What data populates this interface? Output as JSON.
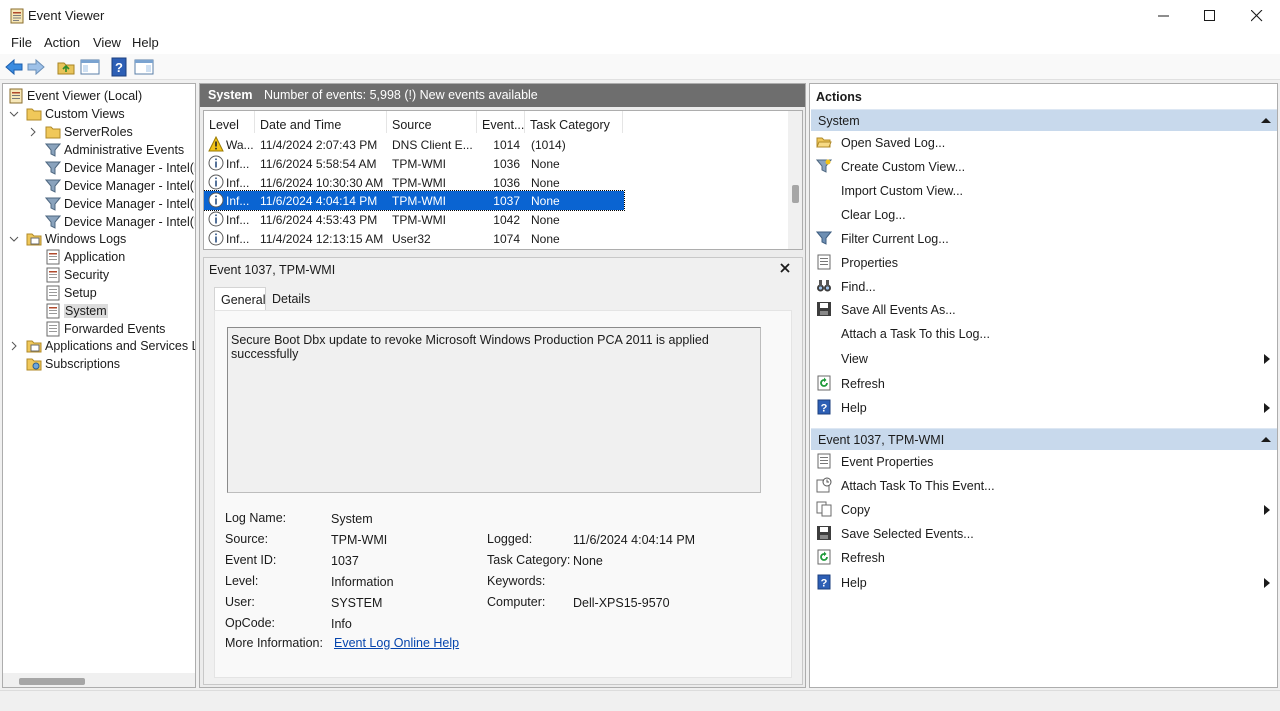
{
  "window": {
    "title": "Event Viewer"
  },
  "menu": {
    "items": [
      "File",
      "Action",
      "View",
      "Help"
    ]
  },
  "tree": {
    "root": "Event Viewer (Local)",
    "custom_views": "Custom Views",
    "custom_children": [
      "ServerRoles",
      "Administrative Events",
      "Device Manager - Intel(R)",
      "Device Manager - Intel(R)",
      "Device Manager - Intel(R)",
      "Device Manager - Intel(R)"
    ],
    "windows_logs": "Windows Logs",
    "windows_children": [
      "Application",
      "Security",
      "Setup",
      "System",
      "Forwarded Events"
    ],
    "apps_services": "Applications and Services Log",
    "subscriptions": "Subscriptions"
  },
  "center": {
    "log_name": "System",
    "summary": "Number of events: 5,998 (!) New events available",
    "columns": [
      "Level",
      "Date and Time",
      "Source",
      "Event...",
      "Task Category"
    ],
    "rows": [
      {
        "level": "Wa...",
        "type": "warning",
        "date": "11/4/2024 2:07:43 PM",
        "source": "DNS Client E...",
        "id": "1014",
        "cat": "(1014)"
      },
      {
        "level": "Inf...",
        "type": "info",
        "date": "11/6/2024 5:58:54 AM",
        "source": "TPM-WMI",
        "id": "1036",
        "cat": "None"
      },
      {
        "level": "Inf...",
        "type": "info",
        "date": "11/6/2024 10:30:30 AM",
        "source": "TPM-WMI",
        "id": "1036",
        "cat": "None"
      },
      {
        "level": "Inf...",
        "type": "info",
        "date": "11/6/2024 4:04:14 PM",
        "source": "TPM-WMI",
        "id": "1037",
        "cat": "None"
      },
      {
        "level": "Inf...",
        "type": "info",
        "date": "11/6/2024 4:53:43 PM",
        "source": "TPM-WMI",
        "id": "1042",
        "cat": "None"
      },
      {
        "level": "Inf...",
        "type": "info",
        "date": "11/4/2024 12:13:15 AM",
        "source": "User32",
        "id": "1074",
        "cat": "None"
      }
    ],
    "selected_row": 3
  },
  "detail": {
    "title": "Event 1037, TPM-WMI",
    "tabs": [
      "General",
      "Details"
    ],
    "message": "Secure Boot Dbx update to revoke Microsoft Windows Production PCA 2011 is applied successfully",
    "labels": {
      "log_name": "Log Name:",
      "source": "Source:",
      "event_id": "Event ID:",
      "level": "Level:",
      "user": "User:",
      "opcode": "OpCode:",
      "more_info": "More Information:",
      "logged": "Logged:",
      "task_category": "Task Category:",
      "keywords": "Keywords:",
      "computer": "Computer:"
    },
    "values": {
      "log_name": "System",
      "source": "TPM-WMI",
      "event_id": "1037",
      "level": "Information",
      "user": "SYSTEM",
      "opcode": "Info",
      "more_info_link": "Event Log Online Help",
      "logged": "11/6/2024 4:04:14 PM",
      "task_category": "None",
      "keywords": "",
      "computer": "Dell-XPS15-9570"
    }
  },
  "actions": {
    "title": "Actions",
    "section1": "System",
    "section1_items": [
      "Open Saved Log...",
      "Create Custom View...",
      "Import Custom View...",
      "Clear Log...",
      "Filter Current Log...",
      "Properties",
      "Find...",
      "Save All Events As...",
      "Attach a Task To this Log...",
      "View",
      "Refresh",
      "Help"
    ],
    "section2": "Event 1037, TPM-WMI",
    "section2_items": [
      "Event Properties",
      "Attach Task To This Event...",
      "Copy",
      "Save Selected Events...",
      "Refresh",
      "Help"
    ]
  },
  "colors": {
    "selection": "#0a64d2",
    "section_header": "#c8d9ec",
    "center_header": "#6e6e6e",
    "link": "#0645ad"
  }
}
